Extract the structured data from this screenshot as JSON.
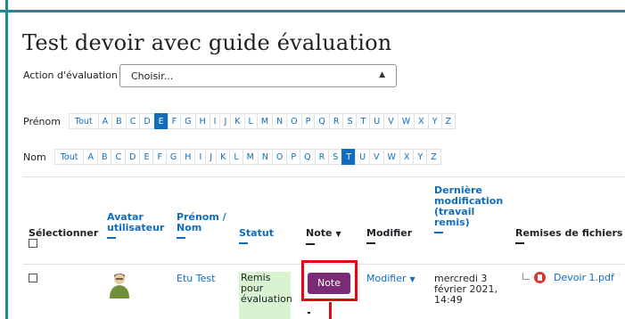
{
  "page": {
    "title": "Test devoir avec guide évaluation"
  },
  "grading_action": {
    "label": "Action d'évaluation",
    "selected": "Choisir..."
  },
  "filters": {
    "firstname_label": "Prénom",
    "lastname_label": "Nom",
    "letters": [
      "Tout",
      "A",
      "B",
      "C",
      "D",
      "E",
      "F",
      "G",
      "H",
      "I",
      "J",
      "K",
      "L",
      "M",
      "N",
      "O",
      "P",
      "Q",
      "R",
      "S",
      "T",
      "U",
      "V",
      "W",
      "X",
      "Y",
      "Z"
    ],
    "firstname_active": "E",
    "lastname_active": "T"
  },
  "table": {
    "headers": {
      "select": "Sélectionner",
      "avatar": "Avatar utilisateur",
      "name": "Prénom / Nom",
      "status": "Statut",
      "grade": "Note",
      "edit": "Modifier",
      "last_modified": "Dernière modification (travail remis)",
      "files": "Remises de fichiers"
    },
    "rows": [
      {
        "name": "Etu Test",
        "status": "Remis pour évaluation",
        "grade_button": "Note",
        "edit_menu": "Modifier",
        "last_modified": "mercredi 3 février 2021, 14:49",
        "file": "Devoir 1.pdf"
      }
    ]
  },
  "colors": {
    "accent": "#0f6cbf",
    "theme_border": "#1b8a8c",
    "grade_button": "#7a2b73",
    "highlight": "#e30613",
    "status_bg": "#d9f2d0"
  },
  "icons": {
    "sort_desc": "caret-down-icon",
    "file": "pdf-icon",
    "avatar": "user-avatar-icon"
  }
}
